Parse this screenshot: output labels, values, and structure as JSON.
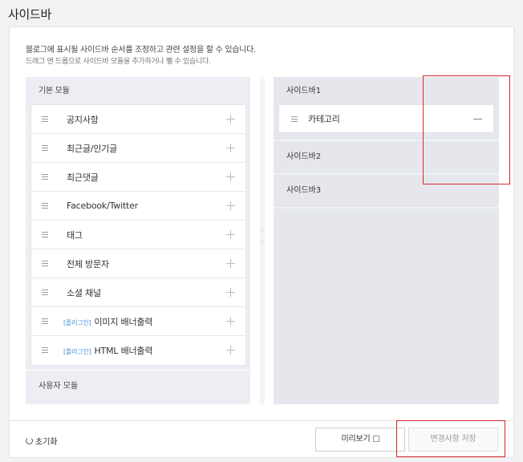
{
  "page": {
    "title": "사이드바",
    "description": "블로그에 표시될 사이드바 순서를 조정하고 관련 설정을 할 수 있습니다.",
    "hint": "드래그 앤 드롭으로 사이드바 모듈을 추가하거나 뺄 수 있습니다."
  },
  "left_column": {
    "basic_header": "기본 모듈",
    "modules": [
      {
        "tag": "",
        "label": "공지사항"
      },
      {
        "tag": "",
        "label": "최근글/인기글"
      },
      {
        "tag": "",
        "label": "최근댓글"
      },
      {
        "tag": "",
        "label": "Facebook/Twitter"
      },
      {
        "tag": "",
        "label": "태그"
      },
      {
        "tag": "",
        "label": "전체 방문자"
      },
      {
        "tag": "",
        "label": "소셜 채널"
      },
      {
        "tag": "[플러그인]",
        "label": "이미지 배너출력"
      },
      {
        "tag": "[플러그인]",
        "label": "HTML 배너출력"
      }
    ],
    "user_header": "사용자 모듈"
  },
  "right_column": {
    "sidebars": [
      {
        "label": "사이드바1",
        "items": [
          "카테고리"
        ]
      },
      {
        "label": "사이드바2",
        "items": []
      },
      {
        "label": "사이드바3",
        "items": []
      }
    ]
  },
  "footer": {
    "reset_label": "초기화",
    "preview_label": "미리보기",
    "save_label": "변경사항 저장"
  },
  "colors": {
    "highlight": "#d9262c",
    "plugin_tag": "#4a90d9"
  }
}
